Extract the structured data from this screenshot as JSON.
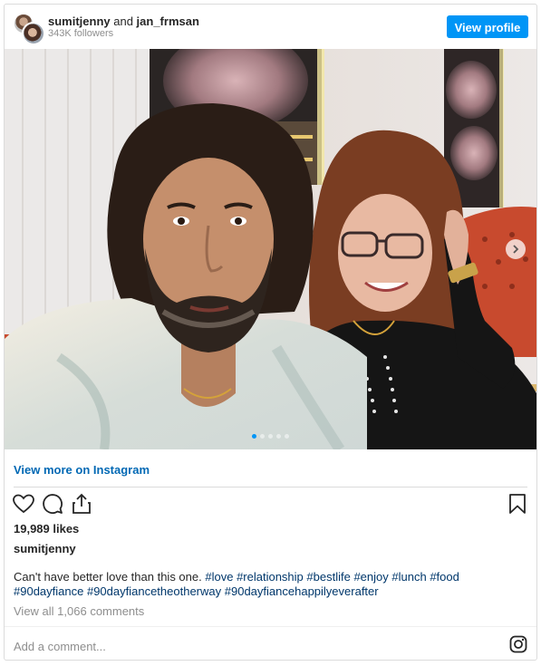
{
  "header": {
    "user_primary": "sumitjenny",
    "connector": " and ",
    "user_secondary": "jan_frmsan",
    "followers": "343K followers",
    "view_profile_label": "View profile"
  },
  "photo": {
    "carousel_total": 5,
    "carousel_active": 1
  },
  "links": {
    "view_more": "View more on Instagram"
  },
  "actions": {
    "icons": [
      "heart-icon",
      "comment-icon",
      "share-icon",
      "bookmark-icon"
    ]
  },
  "post": {
    "likes": "19,989 likes",
    "caption_user": "sumitjenny",
    "caption_text": "Can't have better love than this one.",
    "hashtags": [
      "#love",
      "#relationship",
      "#bestlife",
      "#enjoy",
      "#lunch",
      "#food",
      "#90dayfiance",
      "#90dayfiancetheotherway",
      "#90dayfiancehappilyeverafter"
    ],
    "view_comments": "View all 1,066 comments"
  },
  "comment_box": {
    "placeholder": "Add a comment..."
  },
  "colors": {
    "accent": "#0095f6",
    "link": "#00376b",
    "muted": "#8e8e8e"
  }
}
